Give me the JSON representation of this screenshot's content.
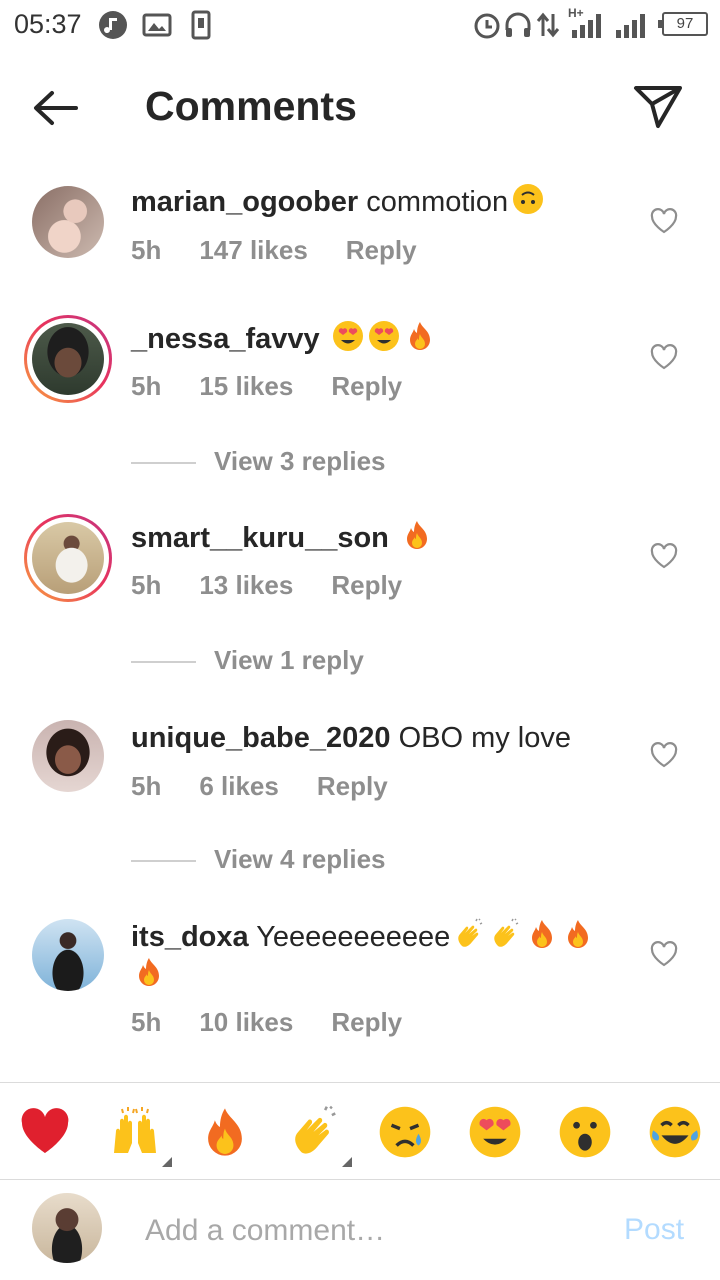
{
  "status_bar": {
    "time": "05:37",
    "battery": "97",
    "network": "H+",
    "left_icons": [
      "music-icon",
      "gallery-icon",
      "sd-card-icon"
    ],
    "right_icons": [
      "alarm-icon",
      "headphones-icon",
      "data-arrows-icon",
      "signal-icon",
      "signal-icon"
    ]
  },
  "header": {
    "title": "Comments",
    "back_icon": "arrow-left-icon",
    "share_icon": "paper-plane-icon"
  },
  "comments": [
    {
      "username": "marian_ogoober",
      "text": "commotion",
      "emojis": [
        "upside-down-face"
      ],
      "time": "5h",
      "likes": "147 likes",
      "reply": "Reply",
      "story_ring": false,
      "avatar_color": "#b9a39b"
    },
    {
      "username": "_nessa_favvy",
      "text": "",
      "emojis": [
        "heart-eyes",
        "heart-eyes",
        "fire"
      ],
      "time": "5h",
      "likes": "15 likes",
      "reply": "Reply",
      "story_ring": true,
      "view_replies": "View 3 replies",
      "avatar_color": "#3c4a3a"
    },
    {
      "username": "smart__kuru__son",
      "text": "",
      "emojis": [
        "fire"
      ],
      "time": "5h",
      "likes": "13 likes",
      "reply": "Reply",
      "story_ring": true,
      "view_replies": "View 1 reply",
      "avatar_color": "#c8b48e"
    },
    {
      "username": "unique_babe_2020",
      "text": "OBO my love",
      "emojis": [],
      "time": "5h",
      "likes": "6 likes",
      "reply": "Reply",
      "story_ring": false,
      "view_replies": "View 4 replies",
      "avatar_color": "#7a5f5a"
    },
    {
      "username": "its_doxa",
      "text": "Yeeeeeeeeeee",
      "emojis": [
        "clapping",
        "clapping",
        "fire",
        "fire",
        "fire"
      ],
      "time": "5h",
      "likes": "10 likes",
      "reply": "Reply",
      "story_ring": false,
      "avatar_color": "#6aa0c8"
    }
  ],
  "emoji_bar": [
    "red-heart",
    "raising-hands",
    "fire",
    "clapping",
    "crying-face",
    "heart-eyes",
    "open-mouth-face",
    "tears-of-joy"
  ],
  "composer": {
    "placeholder": "Add a comment…",
    "post_label": "Post"
  },
  "colors": {
    "text": "#262626",
    "muted": "#8e8e8e",
    "post_disabled": "#b3dbff",
    "story_ring_start": "#f9a33f",
    "story_ring_end": "#c13584"
  }
}
